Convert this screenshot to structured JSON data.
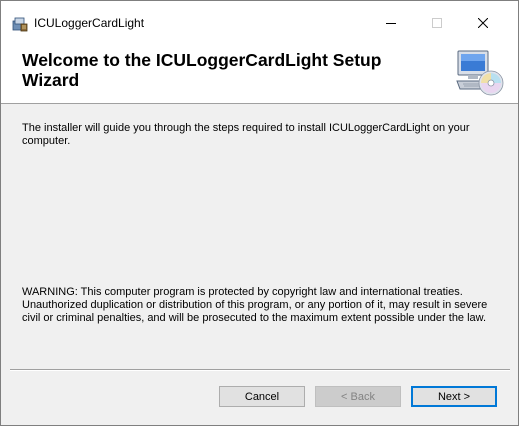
{
  "window": {
    "title": "ICULoggerCardLight",
    "controls": {
      "minimize_icon": "minimize-icon",
      "maximize_icon": "maximize-icon",
      "close_icon": "close-icon"
    }
  },
  "header": {
    "title": "Welcome to the ICULoggerCardLight Setup Wizard",
    "icon": "computer-cd-icon"
  },
  "content": {
    "intro": "The installer will guide you through the steps required to install ICULoggerCardLight on your computer.",
    "warning": "WARNING: This computer program is protected by copyright law and international treaties. Unauthorized duplication or distribution of this program, or any portion of it, may result in severe civil or criminal penalties, and will be prosecuted to the maximum extent possible under the law."
  },
  "buttons": {
    "cancel": "Cancel",
    "back": "< Back",
    "next": "Next >"
  },
  "colors": {
    "accent": "#0078d7",
    "panel": "#f0f0f0",
    "disabled_text": "#838383"
  }
}
